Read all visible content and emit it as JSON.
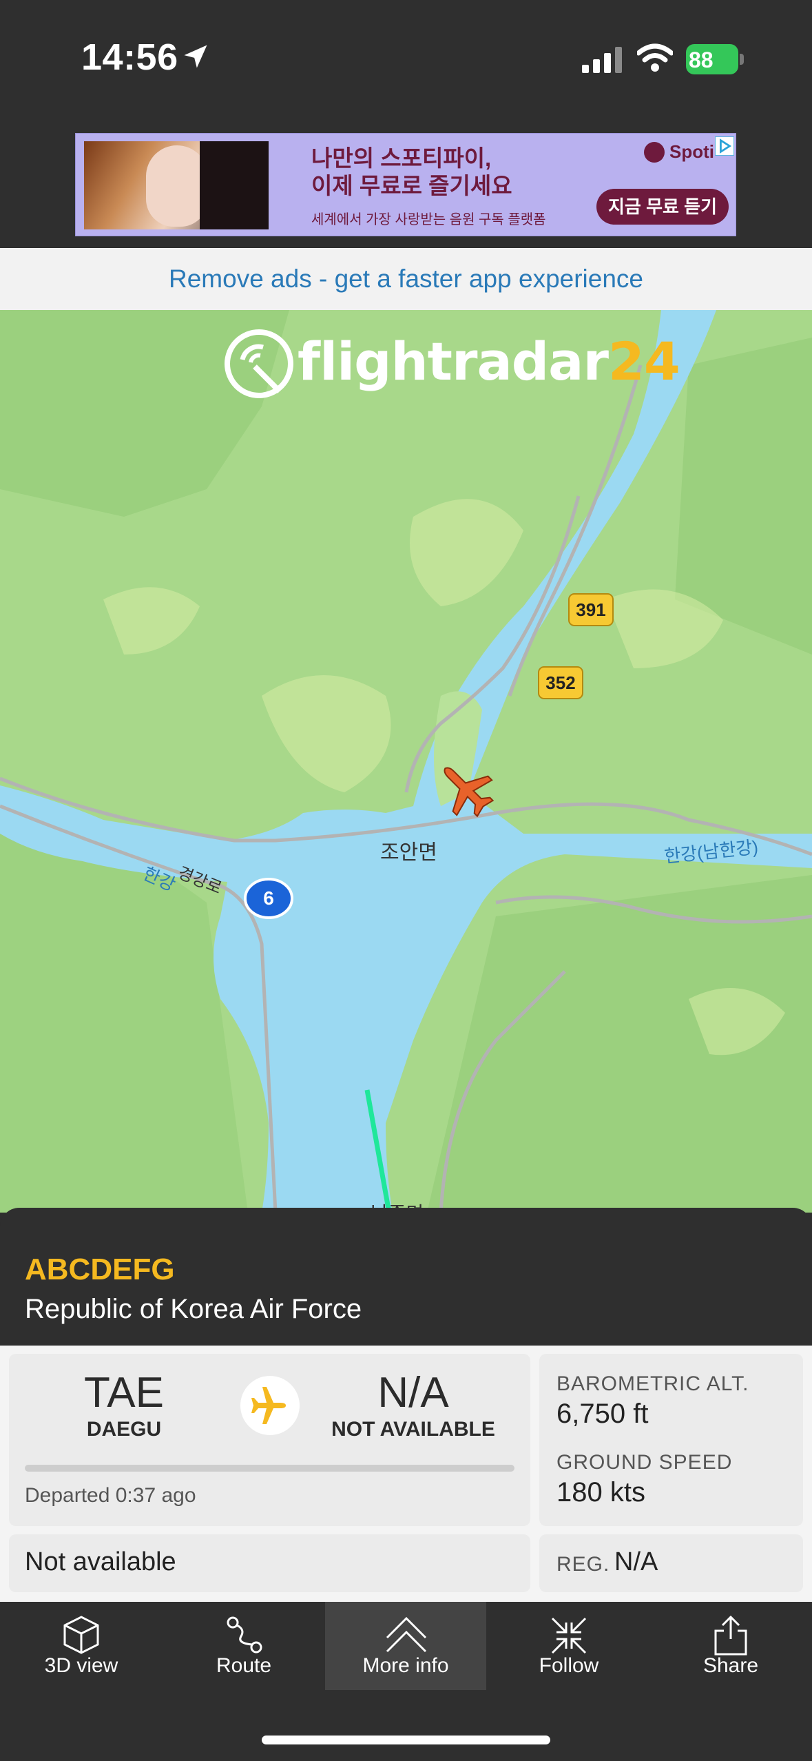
{
  "status_bar": {
    "time": "14:56",
    "battery": "88"
  },
  "ad": {
    "headline_1": "나만의 스포티파이,",
    "headline_2": "이제 무료로 즐기세요",
    "subline": "세계에서 가장 사랑받는 음원 구독 플랫폼",
    "brand": "Spoti",
    "cta": "지금 무료 듣기"
  },
  "remove_ads": "Remove ads - get a faster app experience",
  "map": {
    "logo_text_1": "flightradar",
    "logo_text_2": "24",
    "road_391": "391",
    "road_352": "352",
    "road_6": "6",
    "town_joan": "조안면",
    "road_gyeonggang": "경강로",
    "river_hangang": "한강",
    "river_namhangang": "한강(남한강)",
    "town_bottom": "남종면"
  },
  "flight": {
    "callsign": "ABCDEFG",
    "airline": "Republic of Korea Air Force",
    "departure": {
      "code": "TAE",
      "city": "DAEGU"
    },
    "arrival": {
      "code": "N/A",
      "city": "NOT AVAILABLE"
    },
    "departed": "Departed 0:37 ago",
    "barometric_alt_label": "BAROMETRIC ALT.",
    "barometric_alt": "6,750 ft",
    "ground_speed_label": "GROUND SPEED",
    "ground_speed": "180 kts",
    "aircraft": "Not available",
    "reg_label": "REG.",
    "reg": "N/A"
  },
  "tabs": {
    "view3d": "3D view",
    "route": "Route",
    "more_info": "More info",
    "follow": "Follow",
    "share": "Share"
  },
  "colors": {
    "accent": "#f5b920",
    "link": "#2a7ab8",
    "map_land": "#a8d88a",
    "map_water": "#9bd9f2",
    "aircraft": "#e8622a",
    "track": "#1fe79a"
  }
}
